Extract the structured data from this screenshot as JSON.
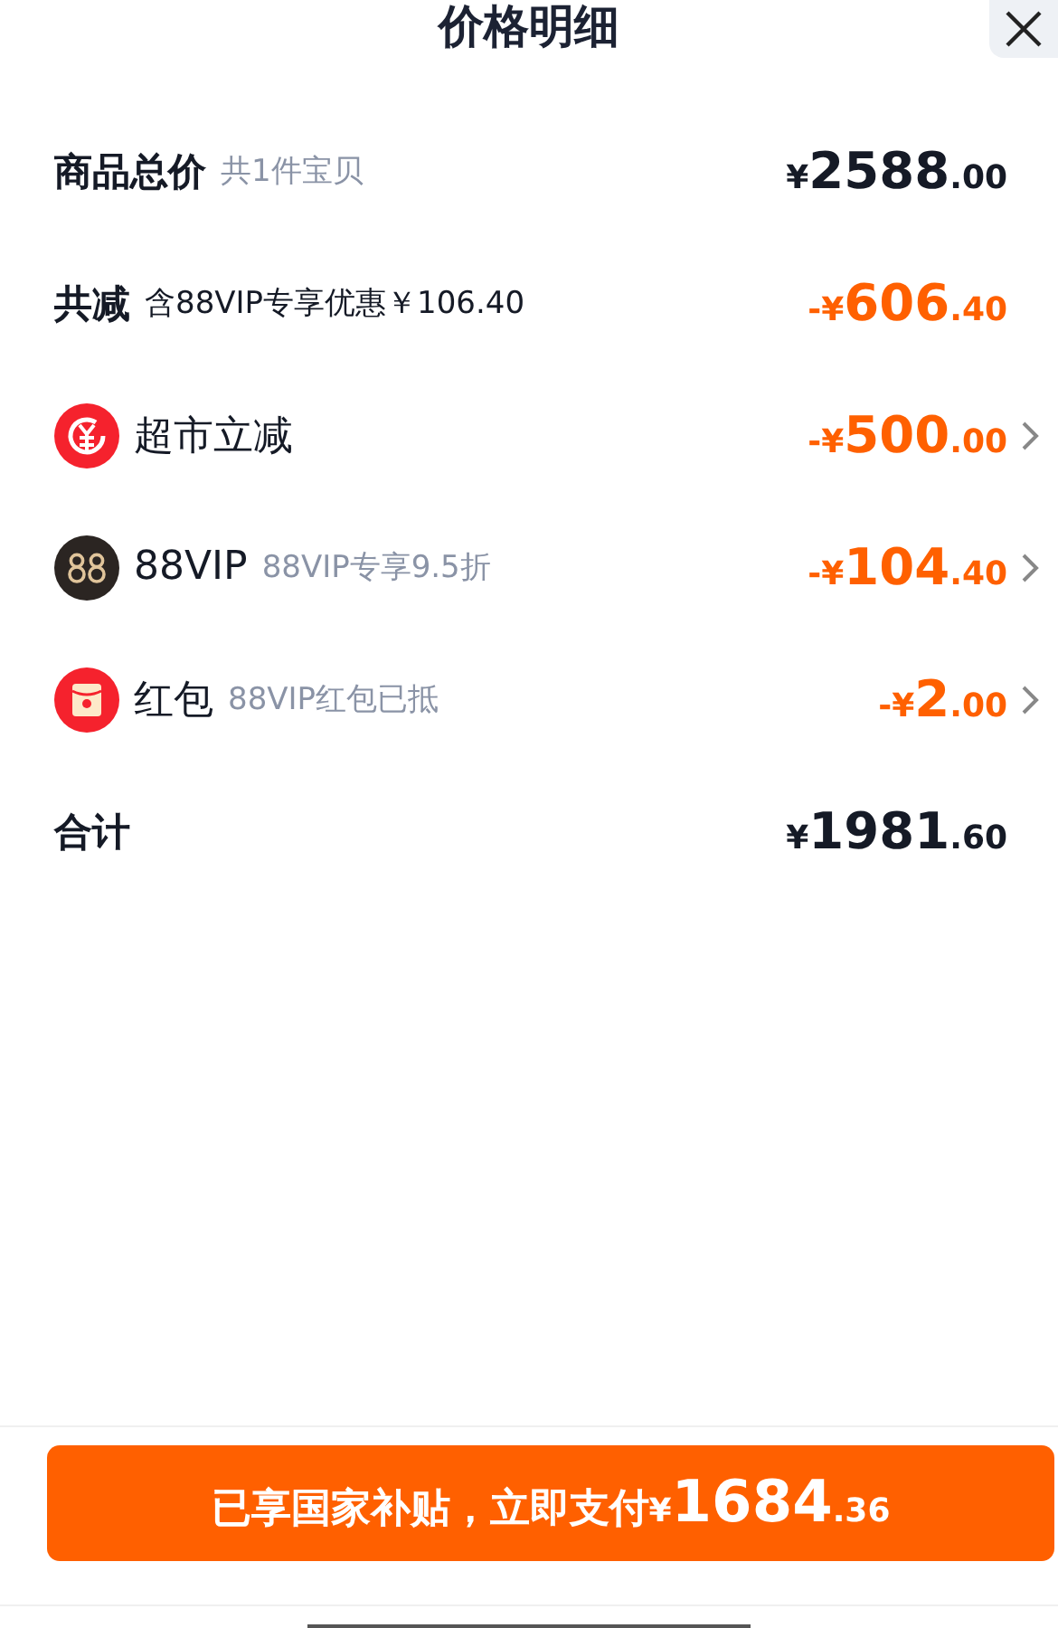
{
  "header": {
    "title": "价格明细"
  },
  "rows": [
    {
      "kind": "plain",
      "label": "商品总价",
      "note": "共1件宝贝",
      "discount": false,
      "price": {
        "prefix": "¥",
        "integer": "2588",
        "decimal": ".00"
      },
      "chevron": false
    },
    {
      "kind": "plain",
      "label": "共减",
      "note": "含88VIP专享优惠￥106.40",
      "note_muted": false,
      "discount": true,
      "price": {
        "prefix": "-¥",
        "integer": "606",
        "decimal": ".40"
      },
      "chevron": false
    },
    {
      "kind": "supermarket",
      "label": "超市立减",
      "discount": true,
      "price": {
        "prefix": "-¥",
        "integer": "500",
        "decimal": ".00"
      },
      "chevron": true
    },
    {
      "kind": "vip",
      "label": "88VIP",
      "note": "88VIP专享9.5折",
      "discount": true,
      "price": {
        "prefix": "-¥",
        "integer": "104",
        "decimal": ".40"
      },
      "chevron": true
    },
    {
      "kind": "redpacket",
      "label": "红包",
      "note": "88VIP红包已抵",
      "discount": true,
      "price": {
        "prefix": "-¥",
        "integer": "2",
        "decimal": ".00"
      },
      "chevron": true
    },
    {
      "kind": "plain",
      "label": "合计",
      "discount": false,
      "price": {
        "prefix": "¥",
        "integer": "1981",
        "decimal": ".60"
      },
      "chevron": false
    }
  ],
  "pay_button": {
    "label": "已享国家补贴，立即支付",
    "price": {
      "prefix": "¥",
      "integer": "1684",
      "decimal": ".36"
    }
  }
}
